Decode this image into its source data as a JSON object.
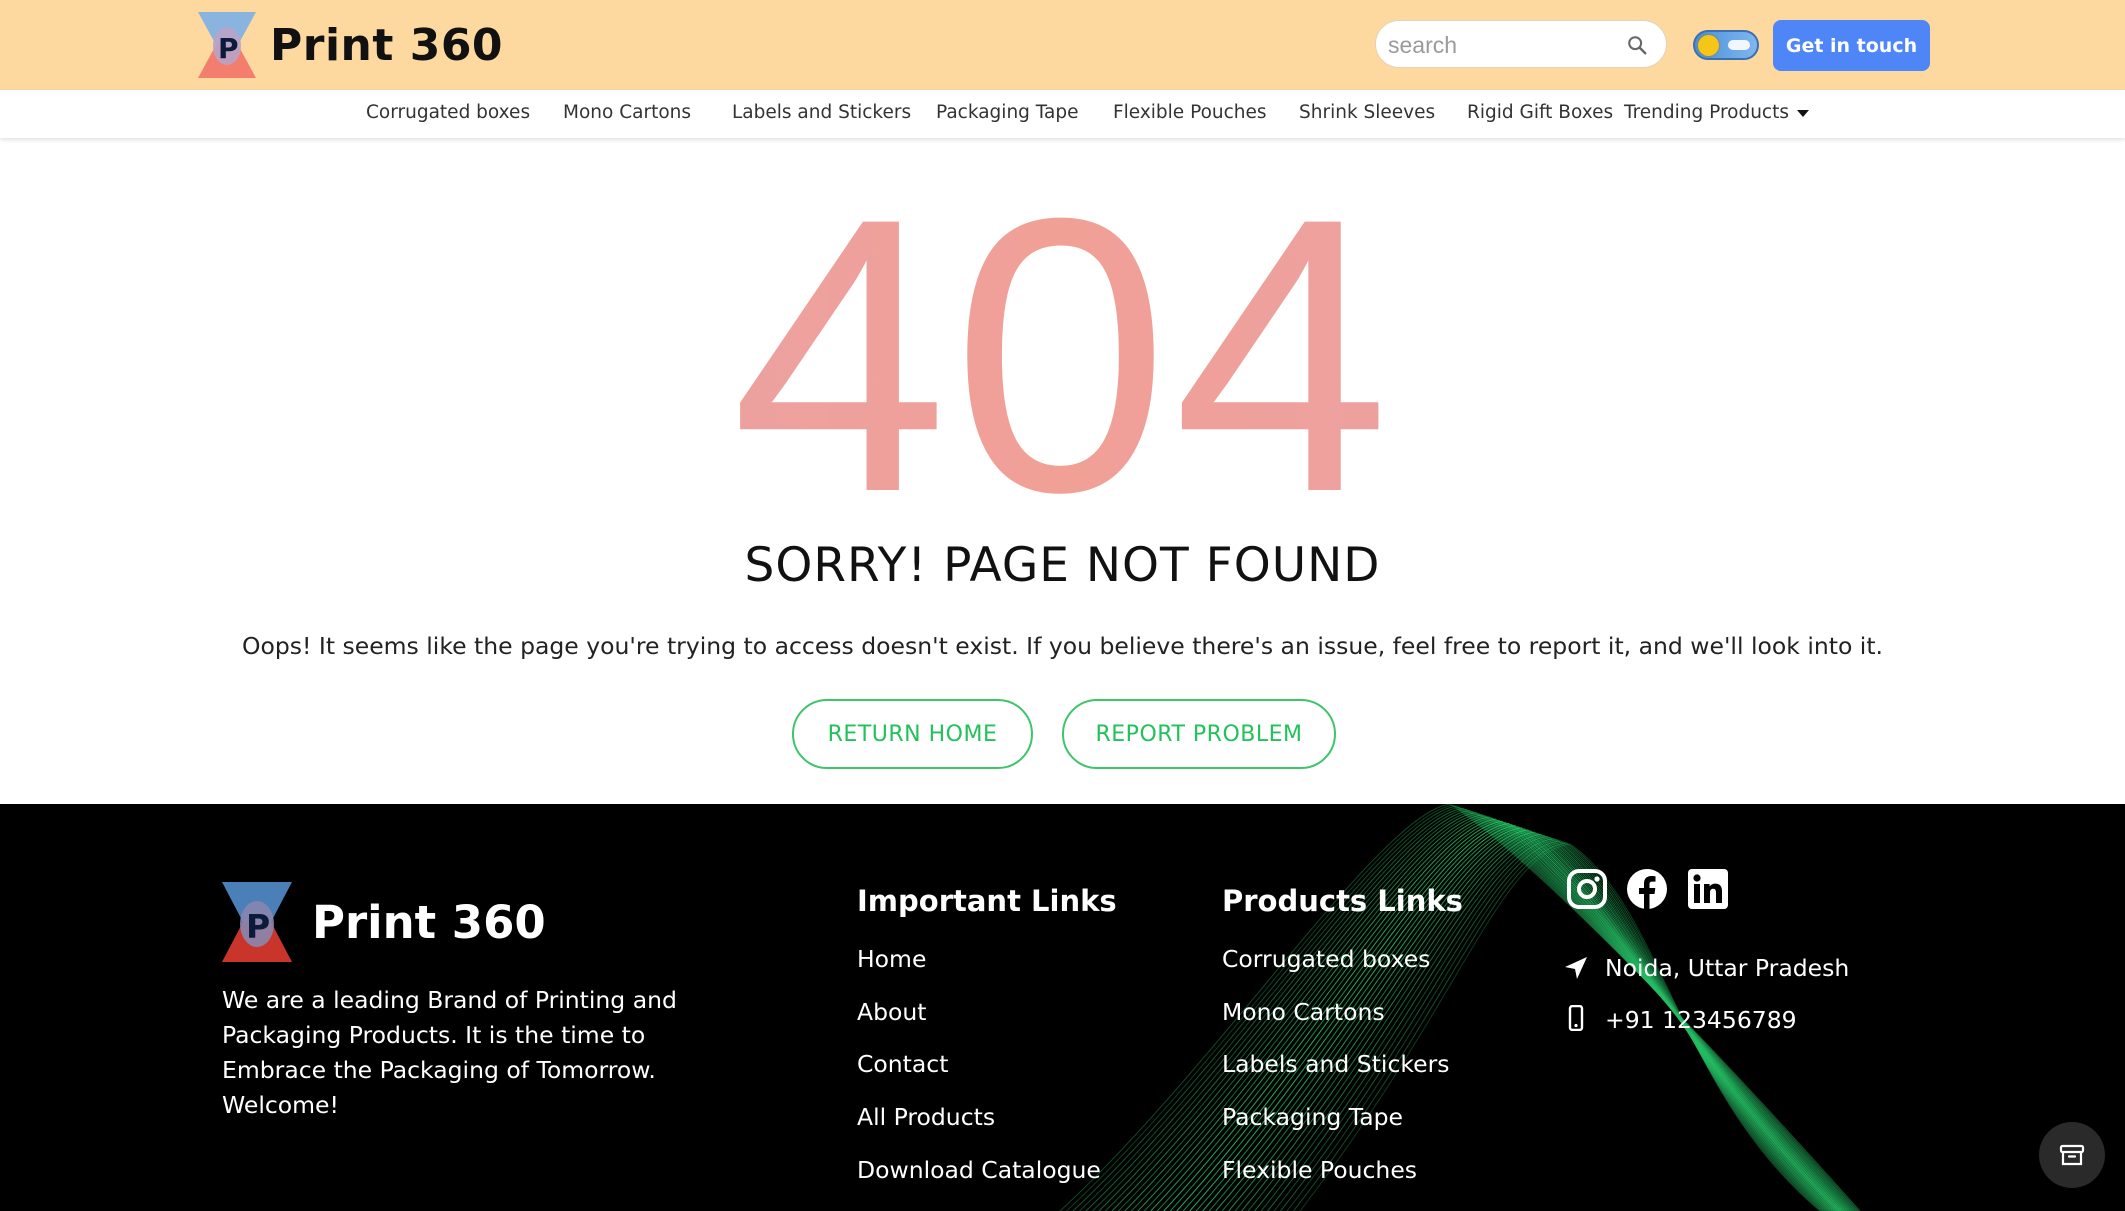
{
  "header": {
    "brand_name": "Print 360",
    "search_placeholder": "search",
    "cta_label": "Get in touch",
    "colors": {
      "topbar": "#fdd9a0",
      "cta": "#4e86f7"
    }
  },
  "nav": {
    "items": [
      {
        "label": "Corrugated boxes"
      },
      {
        "label": "Mono Cartons"
      },
      {
        "label": "Labels and Stickers"
      },
      {
        "label": "Packaging Tape"
      },
      {
        "label": "Flexible Pouches"
      },
      {
        "label": "Shrink Sleeves"
      },
      {
        "label": "Rigid Gift Boxes"
      },
      {
        "label": "Trending Products"
      }
    ]
  },
  "error": {
    "code": "404",
    "title": "SORRY! PAGE NOT FOUND",
    "description": "Oops! It seems like the page you're trying to access doesn't exist. If you believe there's an issue, feel free to report it, and we'll look into it.",
    "return_home_label": "RETURN HOME",
    "report_problem_label": "REPORT PROBLEM",
    "colors": {
      "accent_green": "#22c25a",
      "code_pink": "#eaa0a4"
    }
  },
  "footer": {
    "brand_name": "Print 360",
    "about": "We are a leading Brand of Printing and Packaging Products. It is the time to Embrace the Packaging of Tomorrow. Welcome!",
    "important_links": {
      "heading": "Important Links",
      "items": [
        "Home",
        "About",
        "Contact",
        "All Products",
        "Download Catalogue"
      ]
    },
    "product_links": {
      "heading": "Products Links",
      "items": [
        "Corrugated boxes",
        "Mono Cartons",
        "Labels and Stickers",
        "Packaging Tape",
        "Flexible Pouches"
      ]
    },
    "social": [
      "instagram-icon",
      "facebook-icon",
      "linkedin-icon"
    ],
    "contact": {
      "location": "Noida, Uttar Pradesh",
      "phone": "+91 123456789"
    }
  }
}
